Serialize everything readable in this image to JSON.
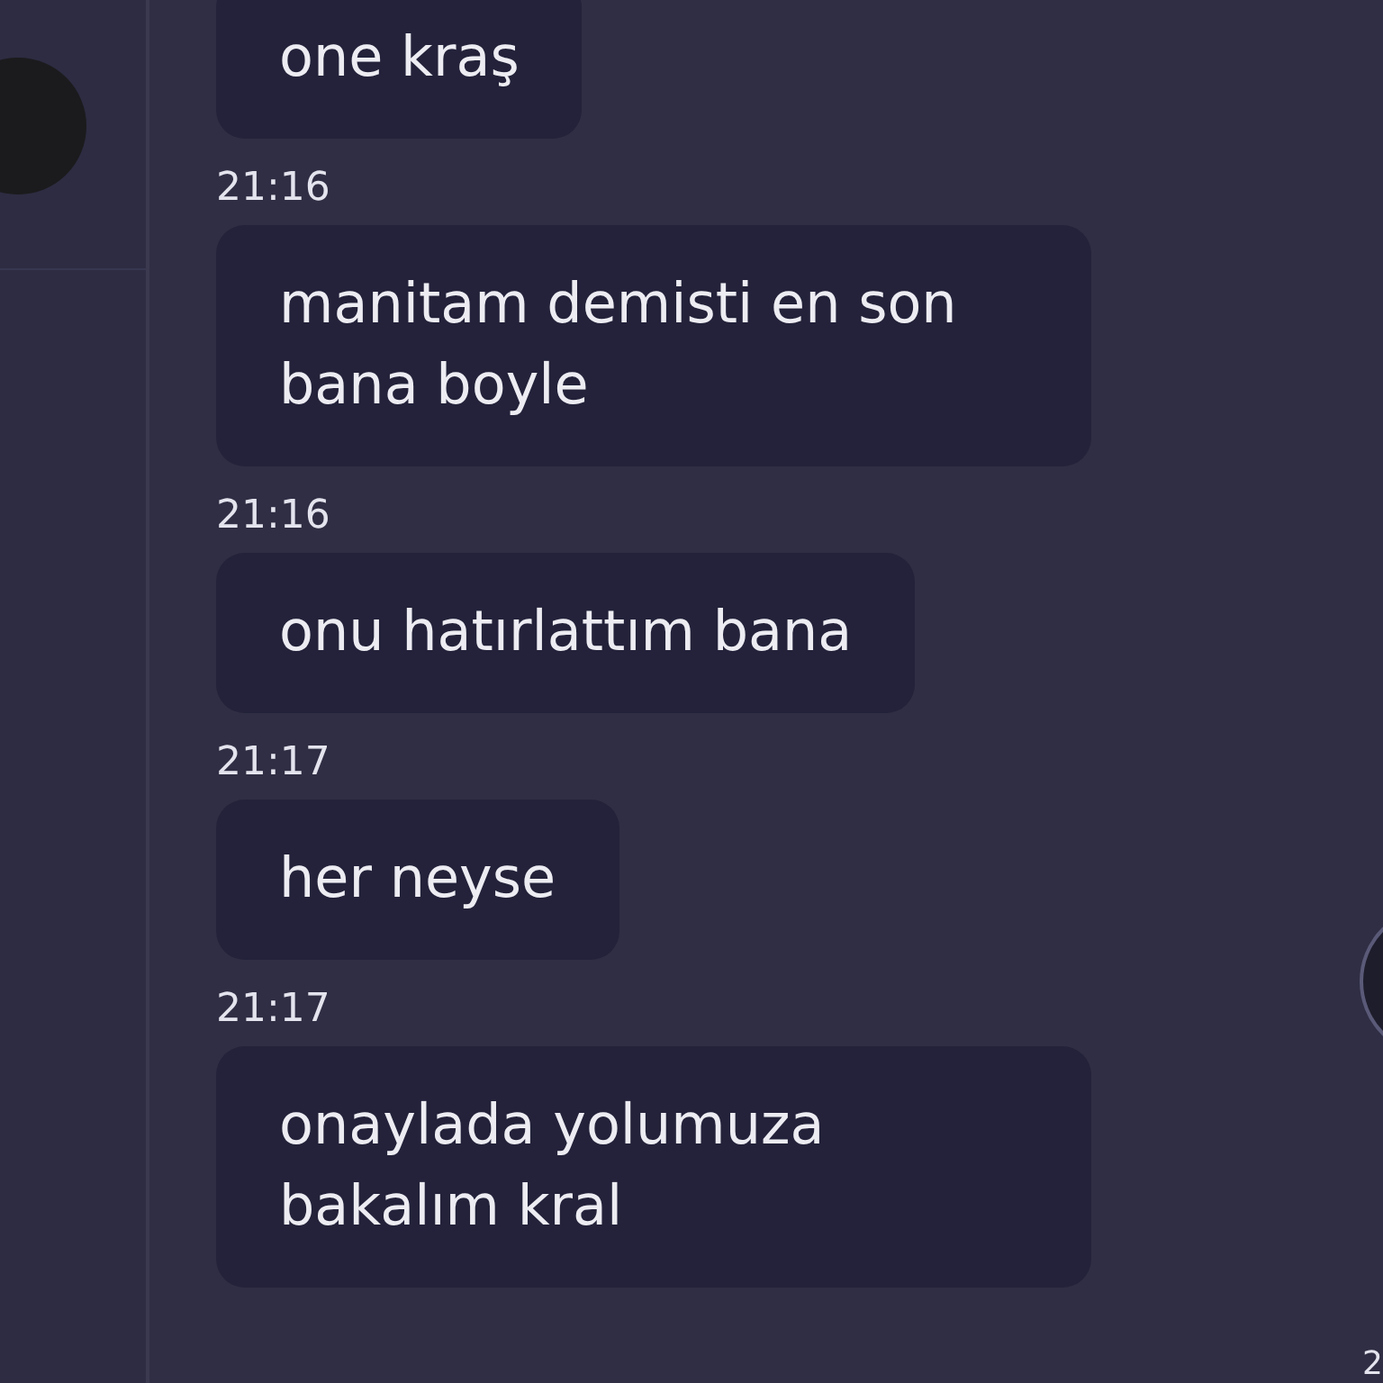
{
  "messages": [
    {
      "text": "one kraş"
    },
    {
      "time": "21:16",
      "text": "manitam demisti en son bana boyle"
    },
    {
      "time": "21:16",
      "text": "onu hatırlattım bana"
    },
    {
      "time": "21:17",
      "text": "her neyse"
    },
    {
      "time": "21:17",
      "text": "onaylada yolumuza bakalım kral"
    }
  ],
  "corner_text": "2"
}
